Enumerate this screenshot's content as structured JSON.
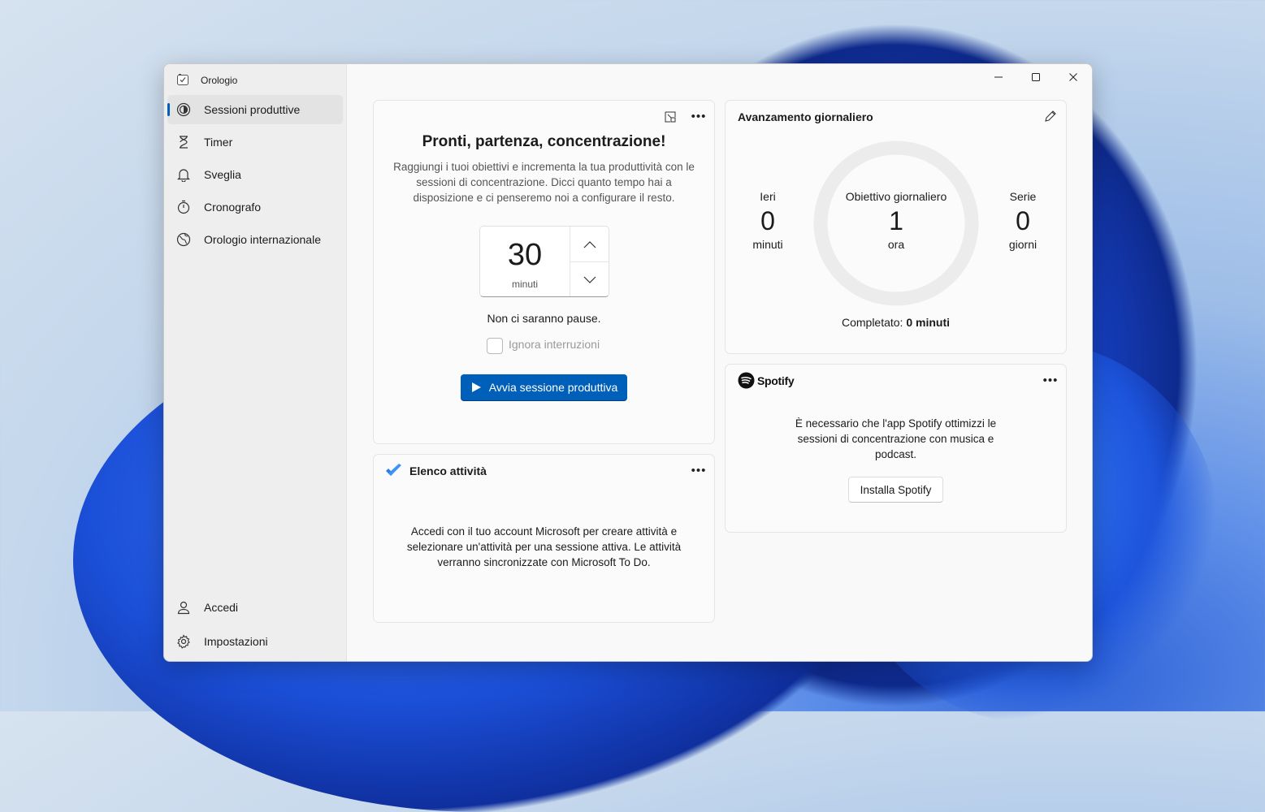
{
  "app": {
    "title": "Orologio"
  },
  "sidebar": {
    "items": [
      {
        "label": "Sessioni produttive",
        "icon": "focus-icon",
        "active": true
      },
      {
        "label": "Timer",
        "icon": "hourglass-icon"
      },
      {
        "label": "Sveglia",
        "icon": "bell-icon"
      },
      {
        "label": "Cronografo",
        "icon": "stopwatch-icon"
      },
      {
        "label": "Orologio internazionale",
        "icon": "globe-icon"
      }
    ],
    "bottom": [
      {
        "label": "Accedi",
        "icon": "person-icon"
      },
      {
        "label": "Impostazioni",
        "icon": "gear-icon"
      }
    ]
  },
  "focus": {
    "title": "Pronti, partenza, concentrazione!",
    "description": "Raggiungi i tuoi obiettivi e incrementa la tua produttività con le sessioni di concentrazione. Dicci quanto tempo hai a disposizione e ci penseremo noi a configurare il resto.",
    "minutes_value": "30",
    "minutes_unit": "minuti",
    "breaks_text": "Non ci saranno pause.",
    "skip_breaks_label": "Ignora interruzioni",
    "skip_breaks_checked": false,
    "start_button": "Avvia sessione produttiva"
  },
  "tasks": {
    "title": "Elenco attività",
    "message": "Accedi con il tuo account Microsoft per creare attività e selezionare un'attività per una sessione attiva. Le attività verranno sincronizzate con Microsoft To Do."
  },
  "progress": {
    "title": "Avanzamento giornaliero",
    "yesterday": {
      "label": "Ieri",
      "value": "0",
      "unit": "minuti"
    },
    "goal": {
      "label": "Obiettivo giornaliero",
      "value": "1",
      "unit": "ora"
    },
    "streak": {
      "label": "Serie",
      "value": "0",
      "unit": "giorni"
    },
    "completed_label": "Completato:",
    "completed_value": "0 minuti",
    "ring_fraction": 0
  },
  "spotify": {
    "brand": "Spotify",
    "message": "È necessario che l'app Spotify ottimizzi le sessioni di concentrazione con musica e podcast.",
    "install_button": "Installa Spotify"
  },
  "colors": {
    "accent": "#005fb8",
    "ring": "#ececec"
  }
}
